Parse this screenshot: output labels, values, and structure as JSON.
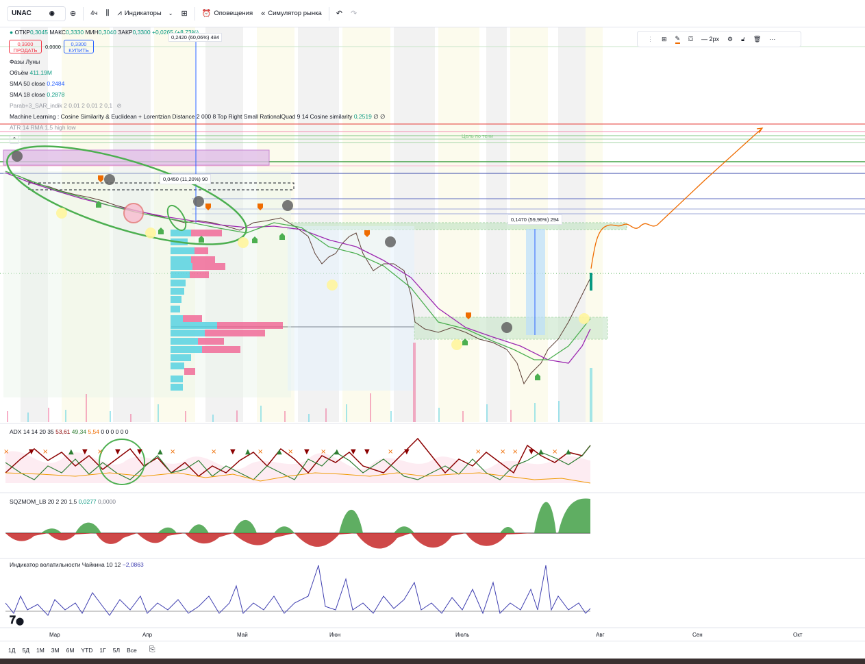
{
  "toolbar": {
    "symbol": "UNAC",
    "interval": "4ч",
    "indicators": "Индикаторы",
    "alerts": "Оповещения",
    "replay": "Симулятор рынка"
  },
  "ohlc": {
    "open_label": "ОТКР",
    "open": "0,3045",
    "high_label": "МАКС",
    "high": "0,3330",
    "low_label": "МИН",
    "low": "0,3040",
    "close_label": "ЗАКР",
    "close": "0,3300",
    "change": "+0,0265 (+8,73%)"
  },
  "trade": {
    "sell_price": "0,3300",
    "sell_label": "ПРОДАТЬ",
    "spread": "0,0000",
    "buy_price": "0,3300",
    "buy_label": "КУПИТЬ"
  },
  "legends": {
    "moon": "Фазы Луны",
    "volume_label": "Объём",
    "volume": "411,19M",
    "sma50_label": "SMA 50 close",
    "sma50": "0,2484",
    "sma18_label": "SMA 18 close",
    "sma18": "0,2878",
    "parab": "Parab+3_SAR_indik 2 0,01 2 0,01 2 0,1",
    "ml": "Machine Learning : Cosine Similarity & Euclidean + Lorentzian Distance 2 000 8 Top Right Small RationalQuad 9 14 Cosine similarity",
    "ml_value": "0,2519",
    "ml_tail": "∅ ∅",
    "atr": "ATR 14 RMA 1,5 high low"
  },
  "annotations": {
    "measure_top": "0,2420 (60,06%) 484",
    "measure_mid": "0,0450 (11,20%) 90",
    "measure_right": "0,1470 (59,96%) 294",
    "target_label": "Цель по тени"
  },
  "drawing_toolbar": {
    "width_label": "2px"
  },
  "panes": {
    "adx": "ADX 14 14 20 35",
    "adx_v1": "53,61",
    "adx_v2": "49,34",
    "adx_v3": "5,54",
    "adx_tail": "0 0 0 0 0 0",
    "sqz": "SQZMOM_LB 20 2 20 1,5",
    "sqz_v1": "0,0277",
    "sqz_v2": "0,0000",
    "chaikin": "Индикатор волатильности Чайкина 10 12",
    "chaikin_v": "−2,0863"
  },
  "time_axis": [
    "Мар",
    "Апр",
    "Май",
    "Июн",
    "Июль",
    "Авг",
    "Сен",
    "Окт"
  ],
  "ranges": [
    "1Д",
    "5Д",
    "1М",
    "3М",
    "6М",
    "YTD",
    "1Г",
    "5Л",
    "Все"
  ],
  "colors": {
    "up": "#089981",
    "down": "#f23645",
    "sma50": "#9c27b0",
    "sma18": "#4caf50",
    "accent": "#2962ff"
  }
}
